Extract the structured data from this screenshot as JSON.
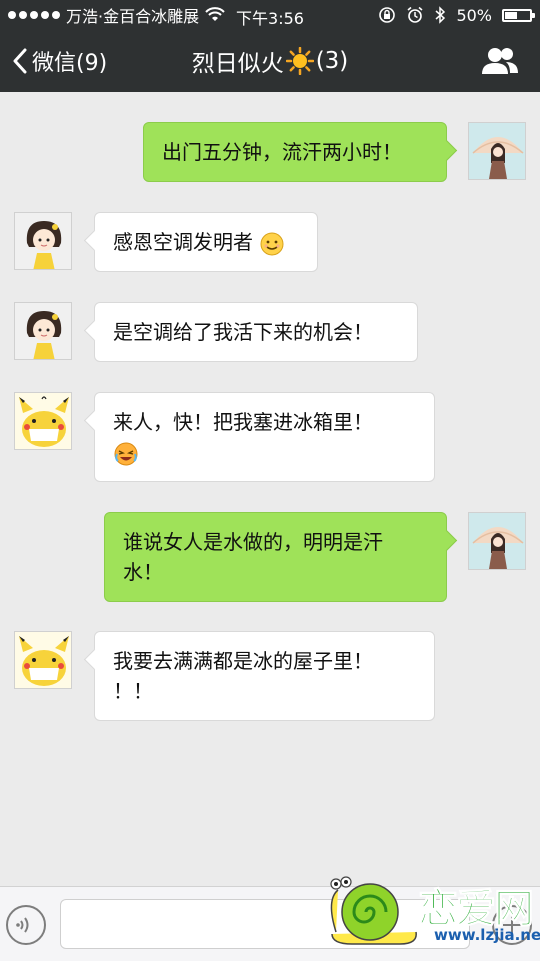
{
  "status_bar": {
    "carrier": "万浩·金百合冰雕展",
    "time": "下午3:56",
    "battery_text": "50%",
    "battery_level": 0.5
  },
  "nav": {
    "back_label": "微信(9)",
    "title_text": "烈日似火",
    "title_count": "(3)",
    "title_emoji": "sun-emoji"
  },
  "messages": [
    {
      "side": "out",
      "sender": "avatar-girl-umbrella",
      "text": "出门五分钟，流汗两小时！"
    },
    {
      "side": "in",
      "sender": "avatar-girl-yellow-dress",
      "text": "感恩空调发明者",
      "emoji": "smile-emoji"
    },
    {
      "side": "in",
      "sender": "avatar-girl-yellow-dress",
      "text": "是空调给了我活下来的机会！"
    },
    {
      "side": "in",
      "sender": "avatar-pikachu",
      "text_line1": "来人，快！把我塞进冰箱里！",
      "emoji": "crying-laughing-emoji"
    },
    {
      "side": "out",
      "sender": "avatar-girl-umbrella",
      "text_line1": "谁说女人是水做的，明明是汗",
      "text_line2": "水！"
    },
    {
      "side": "in",
      "sender": "avatar-pikachu",
      "text_line1": "我要去满满都是冰的屋子里！",
      "text_line2": "！！"
    }
  ],
  "input_bar": {
    "voice_icon": "voice-icon",
    "plus_icon": "plus-icon"
  },
  "watermark": {
    "text_main": "恋爱网",
    "text_url": "www.lzjia.net"
  },
  "colors": {
    "header_bg": "#2e3132",
    "chat_bg": "#ebebeb",
    "out_bubble": "#9fe259",
    "in_bubble": "#ffffff"
  }
}
